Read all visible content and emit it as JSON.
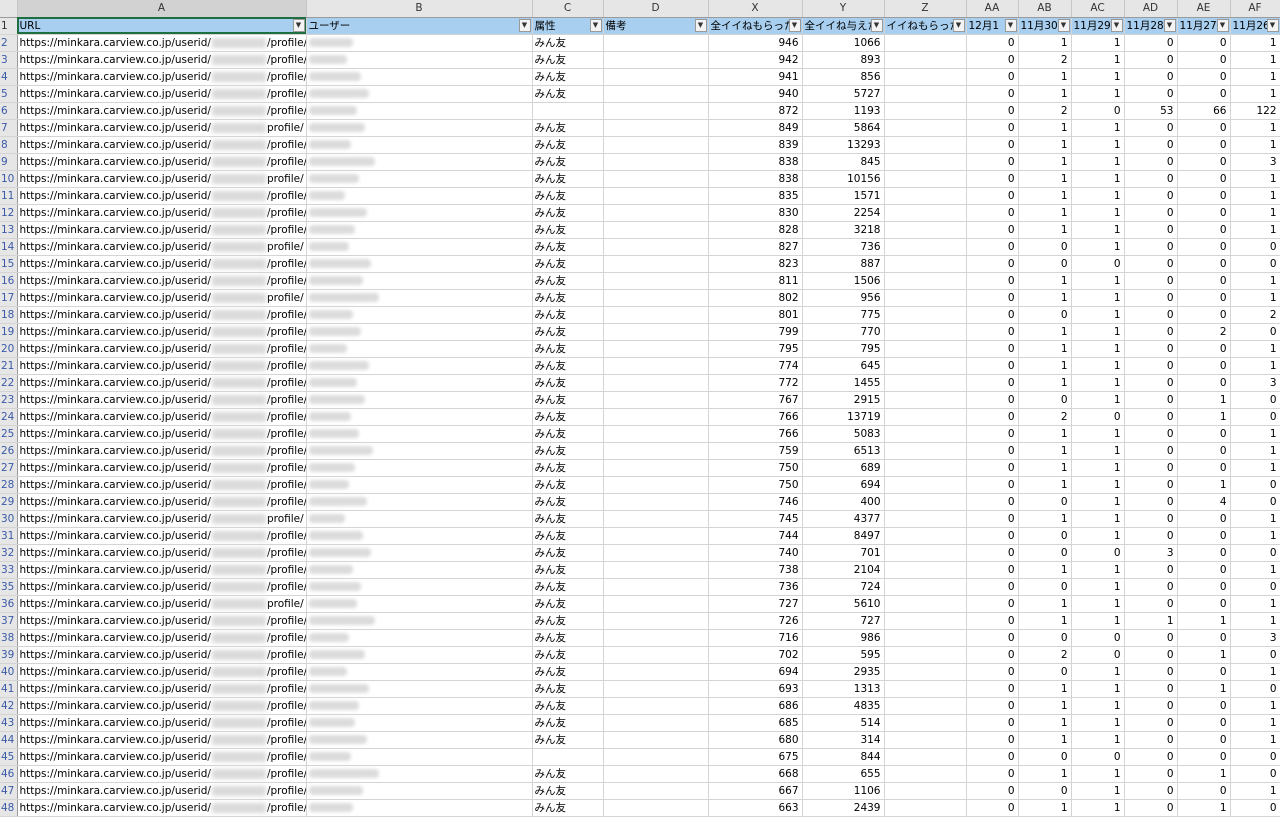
{
  "sheet": {
    "column_letters": [
      "A",
      "B",
      "C",
      "D",
      "X",
      "Y",
      "Z",
      "AA",
      "AB",
      "AC",
      "AD",
      "AE",
      "AF"
    ],
    "header_row_number": "1",
    "headers": [
      "URL",
      "ユーザー",
      "属性",
      "備考",
      "全イイねもらった",
      "全イイね与えた",
      "イイねもらった",
      "12月1",
      "11月30",
      "11月29",
      "11月28",
      "11月27",
      "11月26"
    ],
    "url_prefix": "https://minkara.carview.co.jp/userid/",
    "url_suffix": "/profile/",
    "url_suffix_short": "profile/",
    "rows": [
      {
        "n": "2",
        "u": "",
        "c": "みん友",
        "x": "946",
        "y": "1066",
        "aa": "0",
        "ab": "1",
        "ac": "1",
        "ad": "0",
        "ae": "0",
        "af": "1",
        "s": "l"
      },
      {
        "n": "3",
        "u": "",
        "c": "みん友",
        "x": "942",
        "y": "893",
        "aa": "0",
        "ab": "2",
        "ac": "1",
        "ad": "0",
        "ae": "0",
        "af": "1",
        "s": "l"
      },
      {
        "n": "4",
        "u": "",
        "c": "みん友",
        "x": "941",
        "y": "856",
        "aa": "0",
        "ab": "1",
        "ac": "1",
        "ad": "0",
        "ae": "0",
        "af": "1",
        "s": "l"
      },
      {
        "n": "5",
        "u": "",
        "c": "みん友",
        "x": "940",
        "y": "5727",
        "aa": "0",
        "ab": "1",
        "ac": "1",
        "ad": "0",
        "ae": "0",
        "af": "1",
        "s": "l"
      },
      {
        "n": "6",
        "u": "",
        "c": "",
        "x": "872",
        "y": "1193",
        "aa": "0",
        "ab": "2",
        "ac": "0",
        "ad": "53",
        "ae": "66",
        "af": "122",
        "s": "l"
      },
      {
        "n": "7",
        "u": "",
        "c": "みん友",
        "x": "849",
        "y": "5864",
        "aa": "0",
        "ab": "1",
        "ac": "1",
        "ad": "0",
        "ae": "0",
        "af": "1",
        "s": "s"
      },
      {
        "n": "8",
        "u": "",
        "c": "みん友",
        "x": "839",
        "y": "13293",
        "aa": "0",
        "ab": "1",
        "ac": "1",
        "ad": "0",
        "ae": "0",
        "af": "1",
        "s": "l"
      },
      {
        "n": "9",
        "u": "",
        "c": "みん友",
        "x": "838",
        "y": "845",
        "aa": "0",
        "ab": "1",
        "ac": "1",
        "ad": "0",
        "ae": "0",
        "af": "3",
        "s": "l"
      },
      {
        "n": "10",
        "u": "",
        "c": "みん友",
        "x": "838",
        "y": "10156",
        "aa": "0",
        "ab": "1",
        "ac": "1",
        "ad": "0",
        "ae": "0",
        "af": "1",
        "s": "s"
      },
      {
        "n": "11",
        "u": "",
        "c": "みん友",
        "x": "835",
        "y": "1571",
        "aa": "0",
        "ab": "1",
        "ac": "1",
        "ad": "0",
        "ae": "0",
        "af": "1",
        "s": "l"
      },
      {
        "n": "12",
        "u": "",
        "c": "みん友",
        "x": "830",
        "y": "2254",
        "aa": "0",
        "ab": "1",
        "ac": "1",
        "ad": "0",
        "ae": "0",
        "af": "1",
        "s": "l"
      },
      {
        "n": "13",
        "u": "",
        "c": "みん友",
        "x": "828",
        "y": "3218",
        "aa": "0",
        "ab": "1",
        "ac": "1",
        "ad": "0",
        "ae": "0",
        "af": "1",
        "s": "l"
      },
      {
        "n": "14",
        "u": "",
        "c": "みん友",
        "x": "827",
        "y": "736",
        "aa": "0",
        "ab": "0",
        "ac": "1",
        "ad": "0",
        "ae": "0",
        "af": "0",
        "s": "s"
      },
      {
        "n": "15",
        "u": "",
        "c": "みん友",
        "x": "823",
        "y": "887",
        "aa": "0",
        "ab": "0",
        "ac": "0",
        "ad": "0",
        "ae": "0",
        "af": "0",
        "s": "l"
      },
      {
        "n": "16",
        "u": "",
        "c": "みん友",
        "x": "811",
        "y": "1506",
        "aa": "0",
        "ab": "1",
        "ac": "1",
        "ad": "0",
        "ae": "0",
        "af": "1",
        "s": "l"
      },
      {
        "n": "17",
        "u": "",
        "c": "みん友",
        "x": "802",
        "y": "956",
        "aa": "0",
        "ab": "1",
        "ac": "1",
        "ad": "0",
        "ae": "0",
        "af": "1",
        "s": "s"
      },
      {
        "n": "18",
        "u": "",
        "c": "みん友",
        "x": "801",
        "y": "775",
        "aa": "0",
        "ab": "0",
        "ac": "1",
        "ad": "0",
        "ae": "0",
        "af": "2",
        "s": "l"
      },
      {
        "n": "19",
        "u": "",
        "c": "みん友",
        "x": "799",
        "y": "770",
        "aa": "0",
        "ab": "1",
        "ac": "1",
        "ad": "0",
        "ae": "2",
        "af": "0",
        "s": "l"
      },
      {
        "n": "20",
        "u": "",
        "c": "みん友",
        "x": "795",
        "y": "795",
        "aa": "0",
        "ab": "1",
        "ac": "1",
        "ad": "0",
        "ae": "0",
        "af": "1",
        "s": "l"
      },
      {
        "n": "21",
        "u": "",
        "c": "みん友",
        "x": "774",
        "y": "645",
        "aa": "0",
        "ab": "1",
        "ac": "1",
        "ad": "0",
        "ae": "0",
        "af": "1",
        "s": "l"
      },
      {
        "n": "22",
        "u": "",
        "c": "みん友",
        "x": "772",
        "y": "1455",
        "aa": "0",
        "ab": "1",
        "ac": "1",
        "ad": "0",
        "ae": "0",
        "af": "3",
        "s": "l"
      },
      {
        "n": "23",
        "u": "",
        "c": "みん友",
        "x": "767",
        "y": "2915",
        "aa": "0",
        "ab": "0",
        "ac": "1",
        "ad": "0",
        "ae": "1",
        "af": "0",
        "s": "l"
      },
      {
        "n": "24",
        "u": "",
        "c": "みん友",
        "x": "766",
        "y": "13719",
        "aa": "0",
        "ab": "2",
        "ac": "0",
        "ad": "0",
        "ae": "1",
        "af": "0",
        "s": "l"
      },
      {
        "n": "25",
        "u": "",
        "c": "みん友",
        "x": "766",
        "y": "5083",
        "aa": "0",
        "ab": "1",
        "ac": "1",
        "ad": "0",
        "ae": "0",
        "af": "1",
        "s": "l"
      },
      {
        "n": "26",
        "u": "",
        "c": "みん友",
        "x": "759",
        "y": "6513",
        "aa": "0",
        "ab": "1",
        "ac": "1",
        "ad": "0",
        "ae": "0",
        "af": "1",
        "s": "l"
      },
      {
        "n": "27",
        "u": "",
        "c": "みん友",
        "x": "750",
        "y": "689",
        "aa": "0",
        "ab": "1",
        "ac": "1",
        "ad": "0",
        "ae": "0",
        "af": "1",
        "s": "l"
      },
      {
        "n": "28",
        "u": "",
        "c": "みん友",
        "x": "750",
        "y": "694",
        "aa": "0",
        "ab": "1",
        "ac": "1",
        "ad": "0",
        "ae": "1",
        "af": "0",
        "s": "l"
      },
      {
        "n": "29",
        "u": "",
        "c": "みん友",
        "x": "746",
        "y": "400",
        "aa": "0",
        "ab": "0",
        "ac": "1",
        "ad": "0",
        "ae": "4",
        "af": "0",
        "s": "l"
      },
      {
        "n": "30",
        "u": "",
        "c": "みん友",
        "x": "745",
        "y": "4377",
        "aa": "0",
        "ab": "1",
        "ac": "1",
        "ad": "0",
        "ae": "0",
        "af": "1",
        "s": "s"
      },
      {
        "n": "31",
        "u": "",
        "c": "みん友",
        "x": "744",
        "y": "8497",
        "aa": "0",
        "ab": "0",
        "ac": "1",
        "ad": "0",
        "ae": "0",
        "af": "1",
        "s": "l"
      },
      {
        "n": "32",
        "u": "",
        "c": "みん友",
        "x": "740",
        "y": "701",
        "aa": "0",
        "ab": "0",
        "ac": "0",
        "ad": "3",
        "ae": "0",
        "af": "0",
        "s": "l"
      },
      {
        "n": "33",
        "u": "",
        "c": "みん友",
        "x": "738",
        "y": "2104",
        "aa": "0",
        "ab": "1",
        "ac": "1",
        "ad": "0",
        "ae": "0",
        "af": "1",
        "s": "l"
      },
      {
        "n": "35",
        "u": "",
        "c": "みん友",
        "x": "736",
        "y": "724",
        "aa": "0",
        "ab": "0",
        "ac": "1",
        "ad": "0",
        "ae": "0",
        "af": "0",
        "s": "l"
      },
      {
        "n": "36",
        "u": "",
        "c": "みん友",
        "x": "727",
        "y": "5610",
        "aa": "0",
        "ab": "1",
        "ac": "1",
        "ad": "0",
        "ae": "0",
        "af": "1",
        "s": "s"
      },
      {
        "n": "37",
        "u": "",
        "c": "みん友",
        "x": "726",
        "y": "727",
        "aa": "0",
        "ab": "1",
        "ac": "1",
        "ad": "1",
        "ae": "1",
        "af": "1",
        "s": "l"
      },
      {
        "n": "38",
        "u": "",
        "c": "みん友",
        "x": "716",
        "y": "986",
        "aa": "0",
        "ab": "0",
        "ac": "0",
        "ad": "0",
        "ae": "0",
        "af": "3",
        "s": "l"
      },
      {
        "n": "39",
        "u": "",
        "c": "みん友",
        "x": "702",
        "y": "595",
        "aa": "0",
        "ab": "2",
        "ac": "0",
        "ad": "0",
        "ae": "1",
        "af": "0",
        "s": "l"
      },
      {
        "n": "40",
        "u": "",
        "c": "みん友",
        "x": "694",
        "y": "2935",
        "aa": "0",
        "ab": "0",
        "ac": "1",
        "ad": "0",
        "ae": "0",
        "af": "1",
        "s": "l"
      },
      {
        "n": "41",
        "u": "",
        "c": "みん友",
        "x": "693",
        "y": "1313",
        "aa": "0",
        "ab": "1",
        "ac": "1",
        "ad": "0",
        "ae": "1",
        "af": "0",
        "s": "l"
      },
      {
        "n": "42",
        "u": "",
        "c": "みん友",
        "x": "686",
        "y": "4835",
        "aa": "0",
        "ab": "1",
        "ac": "1",
        "ad": "0",
        "ae": "0",
        "af": "1",
        "s": "l"
      },
      {
        "n": "43",
        "u": "",
        "c": "みん友",
        "x": "685",
        "y": "514",
        "aa": "0",
        "ab": "1",
        "ac": "1",
        "ad": "0",
        "ae": "0",
        "af": "1",
        "s": "l"
      },
      {
        "n": "44",
        "u": "",
        "c": "みん友",
        "x": "680",
        "y": "314",
        "aa": "0",
        "ab": "1",
        "ac": "1",
        "ad": "0",
        "ae": "0",
        "af": "1",
        "s": "l"
      },
      {
        "n": "45",
        "u": "",
        "c": "",
        "x": "675",
        "y": "844",
        "aa": "0",
        "ab": "0",
        "ac": "0",
        "ad": "0",
        "ae": "0",
        "af": "0",
        "s": "l"
      },
      {
        "n": "46",
        "u": "",
        "c": "みん友",
        "x": "668",
        "y": "655",
        "aa": "0",
        "ab": "1",
        "ac": "1",
        "ad": "0",
        "ae": "1",
        "af": "0",
        "s": "l"
      },
      {
        "n": "47",
        "u": "",
        "c": "みん友",
        "x": "667",
        "y": "1106",
        "aa": "0",
        "ab": "0",
        "ac": "1",
        "ad": "0",
        "ae": "0",
        "af": "1",
        "s": "l"
      },
      {
        "n": "48",
        "u": "",
        "c": "みん友",
        "x": "663",
        "y": "2439",
        "aa": "0",
        "ab": "1",
        "ac": "1",
        "ad": "0",
        "ae": "1",
        "af": "0",
        "s": "l"
      }
    ]
  }
}
